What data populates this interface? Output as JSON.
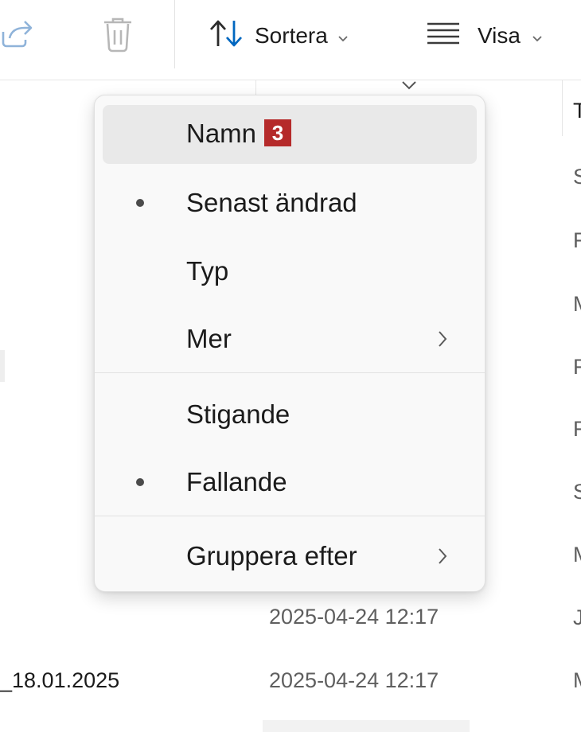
{
  "toolbar": {
    "share_icon": "share-icon",
    "delete_icon": "trash-icon",
    "sort": {
      "label": "Sortera",
      "icon": "sort-arrows-icon"
    },
    "view": {
      "label": "Visa",
      "icon": "lines-icon"
    }
  },
  "menu": {
    "items": [
      {
        "label": "Namn",
        "badge": "3",
        "selected": false,
        "highlighted": true,
        "submenu": false
      },
      {
        "label": "Senast ändrad",
        "selected": true,
        "submenu": false
      },
      {
        "label": "Typ",
        "selected": false,
        "submenu": false
      },
      {
        "label": "Mer",
        "selected": false,
        "submenu": true
      }
    ],
    "order_items": [
      {
        "label": "Stigande",
        "selected": false
      },
      {
        "label": "Fallande",
        "selected": true
      }
    ],
    "group_item": {
      "label": "Gruppera efter",
      "submenu": true
    }
  },
  "list": {
    "type_fragments": [
      "T",
      "S",
      "F",
      "M",
      "F",
      "F",
      "S",
      "M",
      "J",
      "M"
    ],
    "rows": [
      {
        "name": "",
        "date": "2025-04-24 12:17"
      },
      {
        "name": "_18.01.2025",
        "date": "2025-04-24 12:17"
      }
    ]
  },
  "colors": {
    "accent": "#0067c0",
    "badge": "#b52a2a",
    "menu_bg": "#f9f9f9",
    "highlight": "#e9e9e9"
  }
}
